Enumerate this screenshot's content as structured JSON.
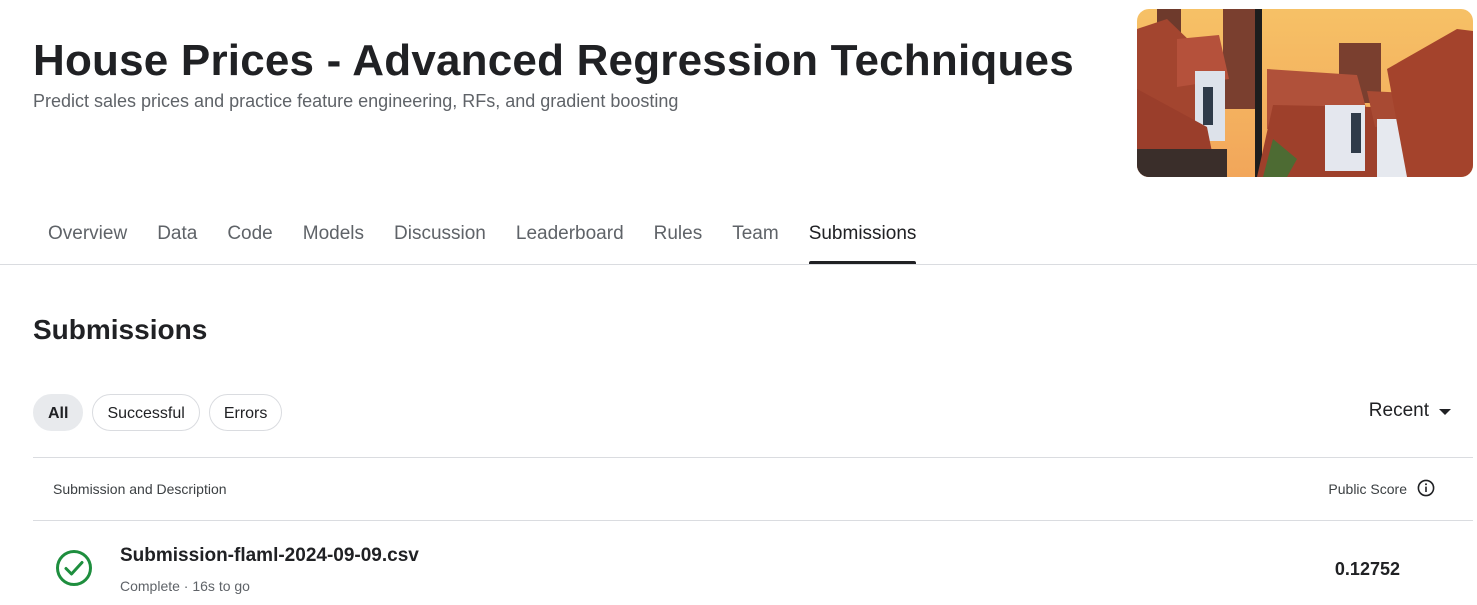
{
  "header": {
    "title": "House Prices - Advanced Regression Techniques",
    "subtitle": "Predict sales prices and practice feature engineering, RFs, and gradient boosting"
  },
  "tabs": [
    "Overview",
    "Data",
    "Code",
    "Models",
    "Discussion",
    "Leaderboard",
    "Rules",
    "Team",
    "Submissions"
  ],
  "active_tab": "Submissions",
  "section": {
    "title": "Submissions"
  },
  "filters": [
    "All",
    "Successful",
    "Errors"
  ],
  "active_filter": "All",
  "sort": {
    "label": "Recent"
  },
  "table": {
    "columns": {
      "submission": "Submission and Description",
      "score": "Public Score"
    },
    "rows": [
      {
        "filename": "Submission-flaml-2024-09-09.csv",
        "meta": "Complete · 16s to go",
        "score": "0.12752",
        "status": "success"
      }
    ]
  },
  "colors": {
    "success": "#1e8e3e",
    "tab_active": "#202124",
    "chip_active_bg": "#e8eaed"
  },
  "icons": {
    "status": "check-circle-icon",
    "info": "info-icon",
    "sort": "caret-down-icon"
  }
}
